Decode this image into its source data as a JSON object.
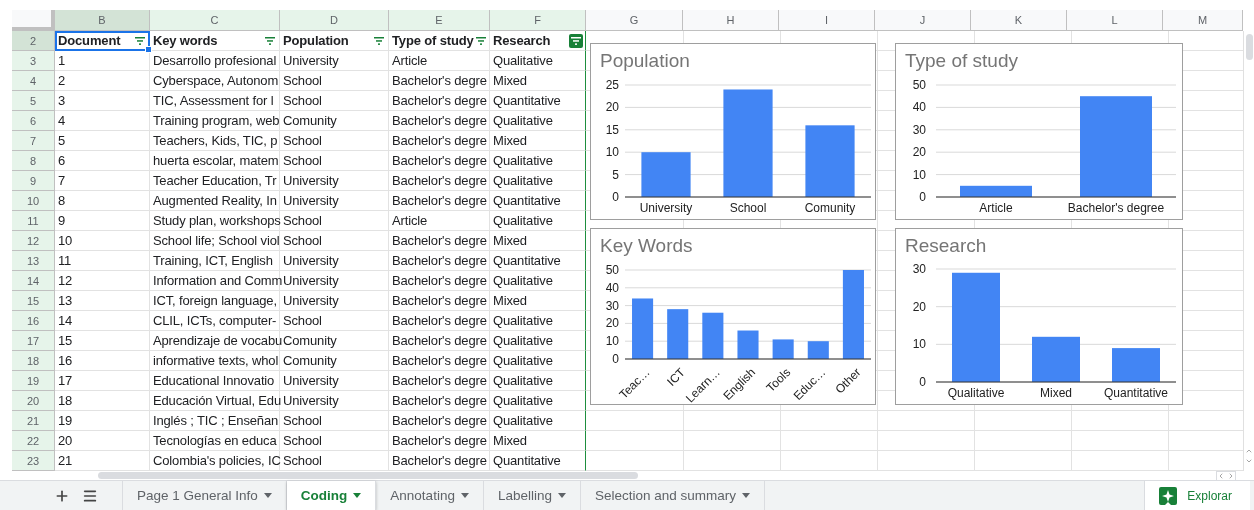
{
  "column_headers": [
    {
      "label": "B",
      "selected": true
    },
    {
      "label": "C",
      "selected": false
    },
    {
      "label": "D",
      "selected": false
    },
    {
      "label": "E",
      "selected": false
    },
    {
      "label": "F",
      "selected": false
    },
    {
      "label": "G",
      "selected": false
    },
    {
      "label": "H",
      "selected": false
    },
    {
      "label": "I",
      "selected": false
    },
    {
      "label": "J",
      "selected": false
    },
    {
      "label": "K",
      "selected": false
    },
    {
      "label": "L",
      "selected": false
    },
    {
      "label": "M",
      "selected": false
    }
  ],
  "table": {
    "header_row_number": "2",
    "columns": [
      {
        "label": "Document",
        "filtered": false,
        "selected": true
      },
      {
        "label": "Key words",
        "filtered": false,
        "selected": false
      },
      {
        "label": "Population",
        "filtered": false,
        "selected": false
      },
      {
        "label": "Type of study",
        "filtered": false,
        "selected": false
      },
      {
        "label": "Research",
        "filtered": true,
        "selected": false
      }
    ],
    "rows": [
      {
        "number": "3",
        "cells": [
          "1",
          "Desarrollo profesional",
          "University",
          "Article",
          "Qualitative"
        ]
      },
      {
        "number": "4",
        "cells": [
          "2",
          "Cyberspace, Autonom",
          "School",
          "Bachelor's degre",
          "Mixed"
        ]
      },
      {
        "number": "5",
        "cells": [
          "3",
          "TIC, Assessment for l",
          "School",
          "Bachelor's degre",
          "Quantitative"
        ]
      },
      {
        "number": "6",
        "cells": [
          "4",
          "Training program, web",
          "Comunity",
          "Bachelor's degre",
          "Qualitative"
        ]
      },
      {
        "number": "7",
        "cells": [
          "5",
          "Teachers, Kids, TIC, p",
          "School",
          "Bachelor's degre",
          "Mixed"
        ]
      },
      {
        "number": "8",
        "cells": [
          "6",
          "huerta escolar, matem",
          "School",
          "Bachelor's degre",
          "Qualitative"
        ]
      },
      {
        "number": "9",
        "cells": [
          "7",
          "Teacher Education, Tr",
          "University",
          "Bachelor's degre",
          "Qualitative"
        ]
      },
      {
        "number": "10",
        "cells": [
          "8",
          "Augmented Reality, In",
          "University",
          "Bachelor's degre",
          "Quantitative"
        ]
      },
      {
        "number": "11",
        "cells": [
          "9",
          "Study plan, workshops",
          "School",
          "Article",
          "Qualitative"
        ]
      },
      {
        "number": "12",
        "cells": [
          "10",
          "School life; School viol",
          "School",
          "Bachelor's degre",
          "Mixed"
        ]
      },
      {
        "number": "13",
        "cells": [
          "11",
          "Training, ICT, English",
          "University",
          "Bachelor's degre",
          "Quantitative"
        ]
      },
      {
        "number": "14",
        "cells": [
          "12",
          "Information and Comm",
          "University",
          "Bachelor's degre",
          "Qualitative"
        ]
      },
      {
        "number": "15",
        "cells": [
          "13",
          "ICT, foreign language,",
          "University",
          "Bachelor's degre",
          "Mixed"
        ]
      },
      {
        "number": "16",
        "cells": [
          "14",
          "CLIL, ICTs, computer-",
          "School",
          "Bachelor's degre",
          "Qualitative"
        ]
      },
      {
        "number": "17",
        "cells": [
          "15",
          "Aprendizaje de vocabu",
          "Comunity",
          "Bachelor's degre",
          "Qualitative"
        ]
      },
      {
        "number": "18",
        "cells": [
          "16",
          "informative texts, whol",
          "Comunity",
          "Bachelor's degre",
          "Qualitative"
        ]
      },
      {
        "number": "19",
        "cells": [
          "17",
          "Educational Innovatio",
          "University",
          "Bachelor's degre",
          "Qualitative"
        ]
      },
      {
        "number": "20",
        "cells": [
          "18",
          "Educación Virtual, Edu",
          "University",
          "Bachelor's degre",
          "Qualitative"
        ]
      },
      {
        "number": "21",
        "cells": [
          "19",
          "Inglés ; TIC ; Enseñan",
          "School",
          "Bachelor's degre",
          "Qualitative"
        ]
      },
      {
        "number": "22",
        "cells": [
          "20",
          "Tecnologías en educa",
          "School",
          "Bachelor's degre",
          "Mixed"
        ]
      },
      {
        "number": "23",
        "cells": [
          "21",
          "Colombia's policies, IC",
          "School",
          "Bachelor's degre",
          "Quantitative"
        ]
      }
    ]
  },
  "charts": [
    {
      "title": "Population",
      "chart_data": {
        "type": "bar",
        "categories": [
          "University",
          "School",
          "Comunity"
        ],
        "values": [
          10,
          24,
          16
        ],
        "grid": true,
        "ylim": [
          0,
          25
        ],
        "yticks": [
          0,
          5,
          10,
          15,
          20,
          25
        ]
      }
    },
    {
      "title": "Type of study",
      "chart_data": {
        "type": "bar",
        "categories": [
          "Article",
          "Bachelor's degree"
        ],
        "values": [
          5,
          45
        ],
        "grid": true,
        "ylim": [
          0,
          50
        ],
        "yticks": [
          0,
          10,
          20,
          30,
          40,
          50
        ]
      }
    },
    {
      "title": "Key Words",
      "chart_data": {
        "type": "bar",
        "categories": [
          "Teac…",
          "ICT",
          "Learn…",
          "English",
          "Tools",
          "Educ…",
          "Other"
        ],
        "values": [
          34,
          28,
          26,
          16,
          11,
          10,
          50
        ],
        "grid": true,
        "ylim": [
          0,
          50
        ],
        "yticks": [
          0,
          10,
          20,
          30,
          40,
          50
        ]
      }
    },
    {
      "title": "Research",
      "chart_data": {
        "type": "bar",
        "categories": [
          "Qualitative",
          "Mixed",
          "Quantitative"
        ],
        "values": [
          29,
          12,
          9
        ],
        "grid": true,
        "ylim": [
          0,
          30
        ],
        "yticks": [
          0,
          10,
          20,
          30
        ]
      }
    }
  ],
  "sheet_tabs": [
    {
      "label": "Page 1 General Info",
      "selected": false
    },
    {
      "label": "Coding",
      "selected": true
    },
    {
      "label": "Annotating",
      "selected": false
    },
    {
      "label": "Labelling",
      "selected": false
    },
    {
      "label": "Selection and summary",
      "selected": false
    }
  ],
  "explore_button": "Explorar"
}
